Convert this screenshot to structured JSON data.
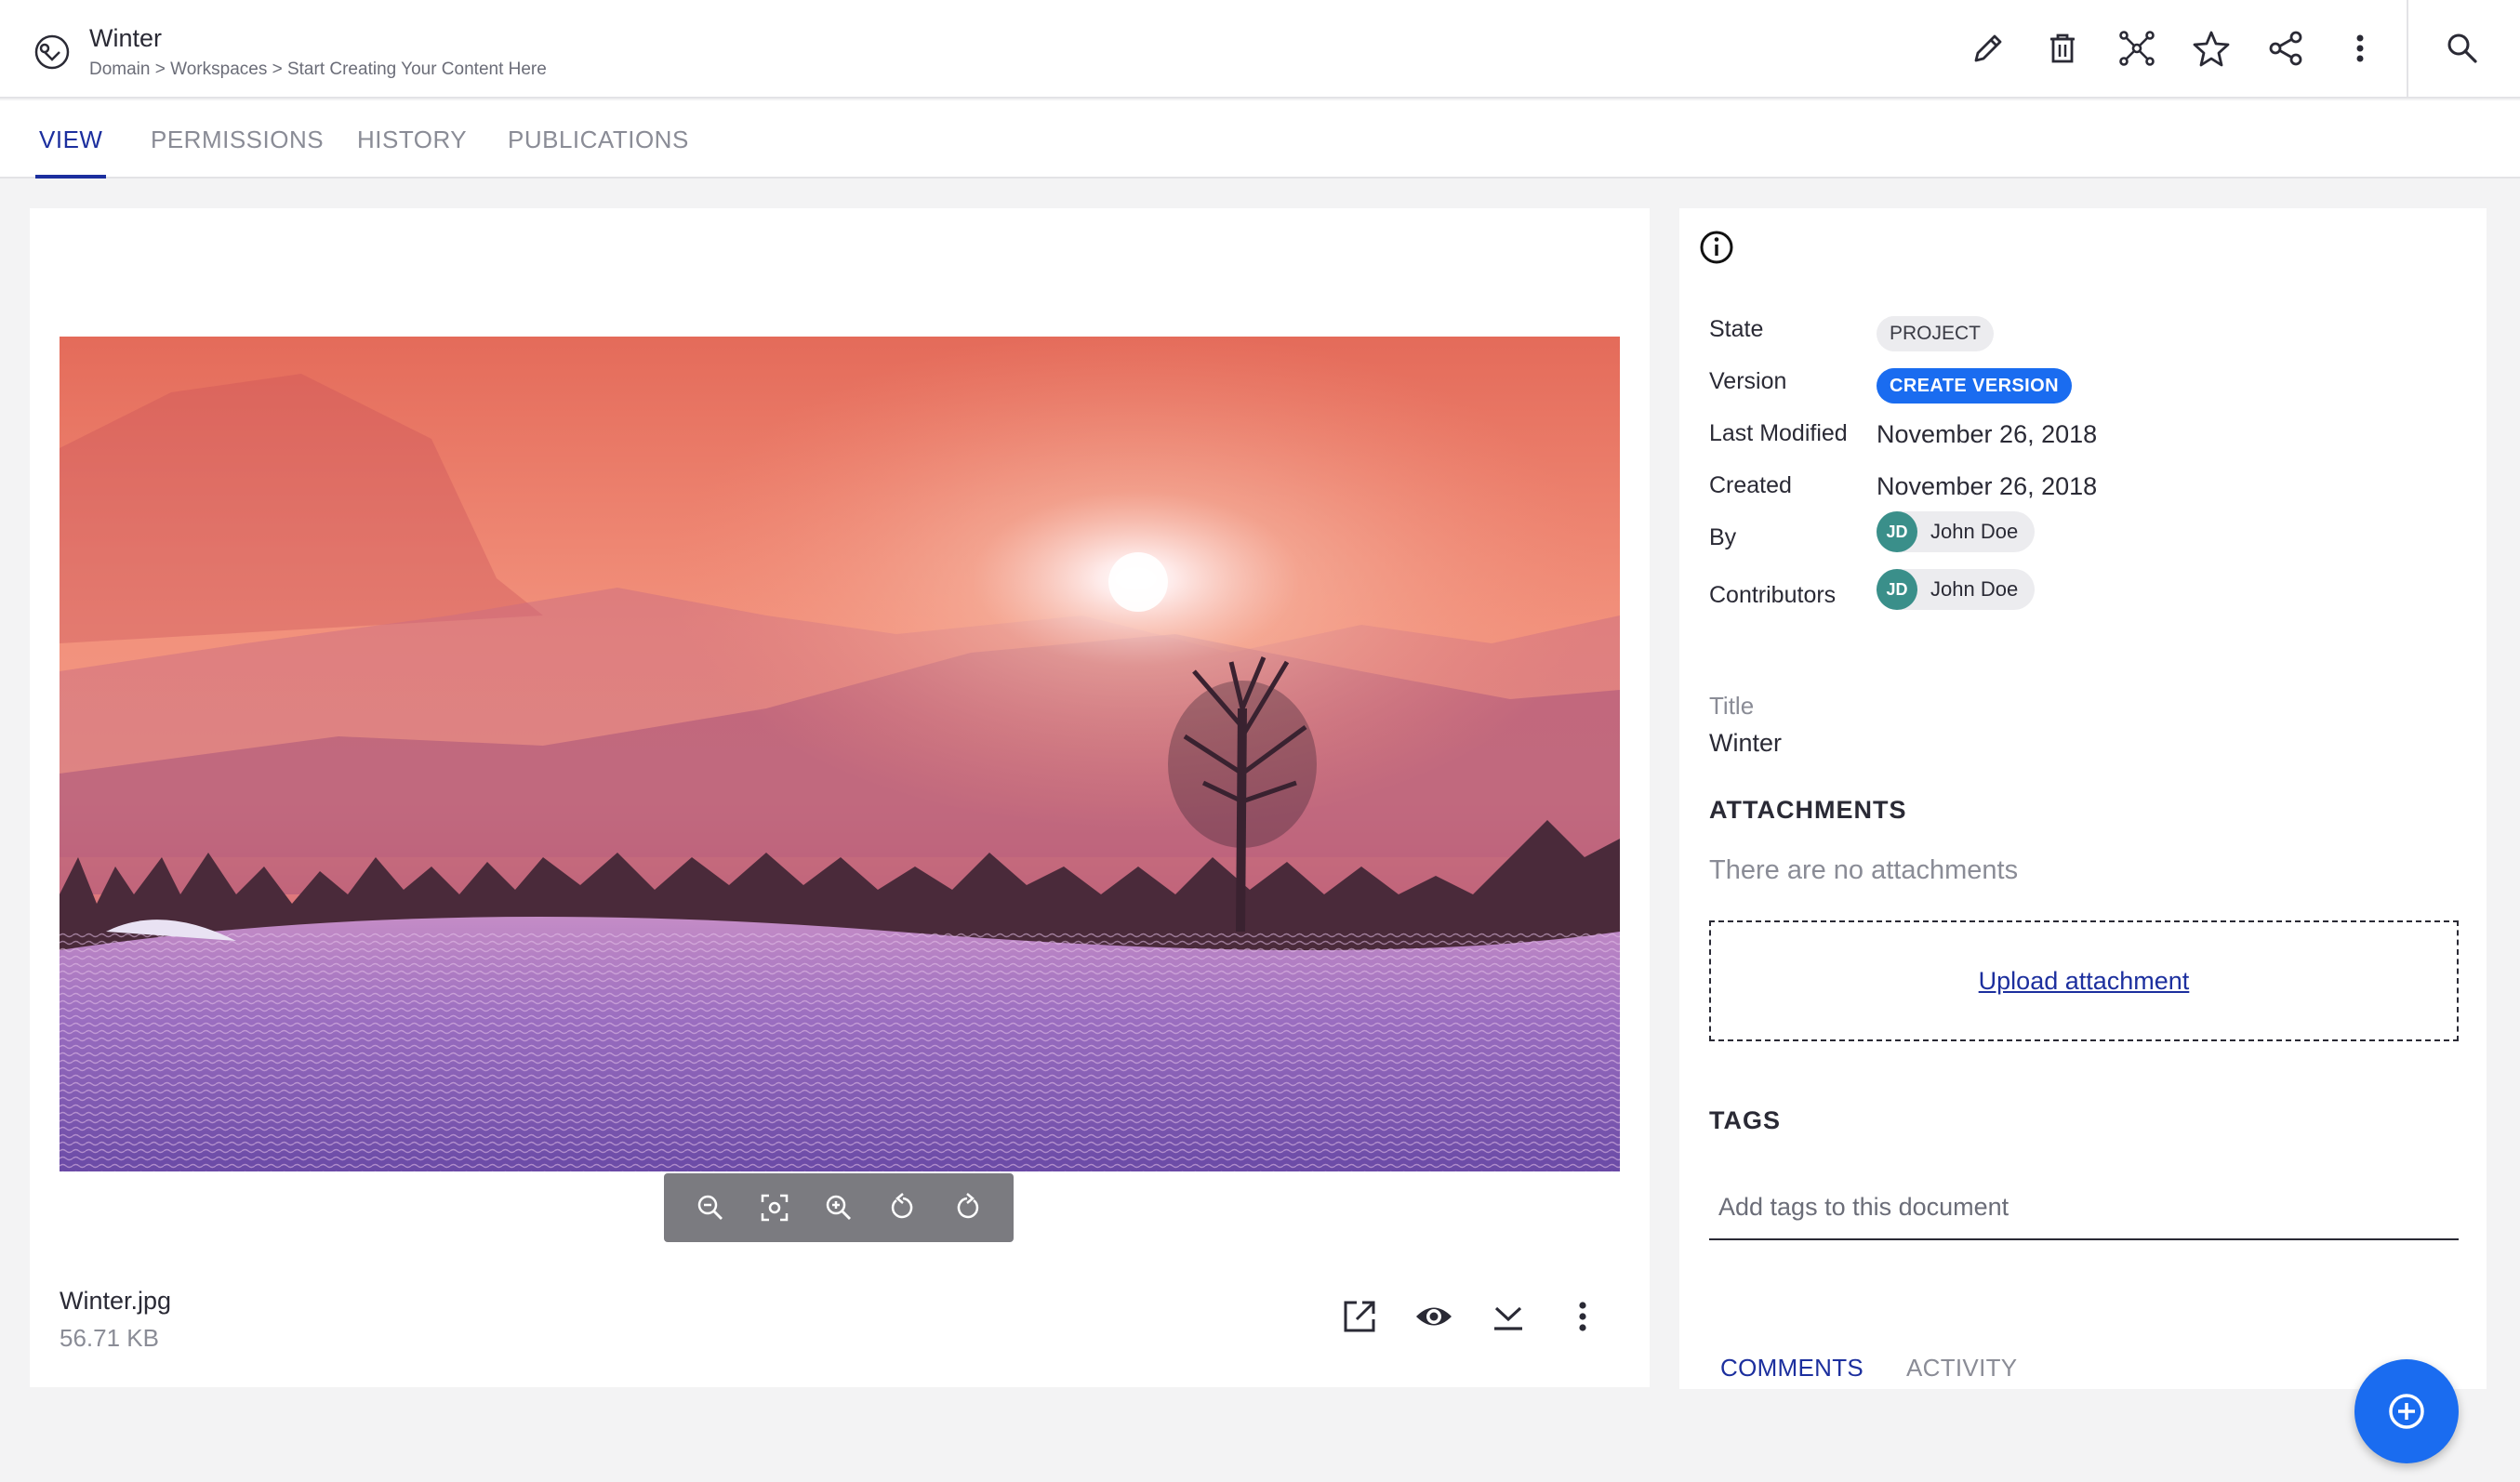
{
  "header": {
    "title": "Winter",
    "breadcrumb": [
      "Domain",
      "Workspaces",
      "Start Creating Your Content Here"
    ],
    "breadcrumb_sep": " > ",
    "actions": [
      "edit-icon",
      "delete-icon",
      "preview-icon",
      "favorite-icon",
      "share-icon",
      "more-icon"
    ],
    "search_icon": "search-icon"
  },
  "tabs": [
    {
      "label": "VIEW",
      "active": true
    },
    {
      "label": "PERMISSIONS",
      "active": false
    },
    {
      "label": "HISTORY",
      "active": false
    },
    {
      "label": "PUBLICATIONS",
      "active": false
    }
  ],
  "viewer": {
    "file_name": "Winter.jpg",
    "file_size": "56.71 KB",
    "zoom_controls": [
      "zoom-out-icon",
      "fit-icon",
      "zoom-in-icon",
      "rotate-left-icon",
      "rotate-right-icon"
    ],
    "file_actions": [
      "open-external-icon",
      "preview-eye-icon",
      "download-icon",
      "more-icon"
    ]
  },
  "info": {
    "labels": {
      "state": "State",
      "version": "Version",
      "last_modified": "Last Modified",
      "created": "Created",
      "by": "By",
      "contributors": "Contributors"
    },
    "state_value": "PROJECT",
    "version_button": "CREATE VERSION",
    "last_modified_value": "November 26, 2018",
    "created_value": "November 26, 2018",
    "by_user": {
      "initials": "JD",
      "name": "John Doe"
    },
    "contributor": {
      "initials": "JD",
      "name": "John Doe"
    },
    "title_label": "Title",
    "title_value": "Winter",
    "attachments_title": "ATTACHMENTS",
    "no_attachments": "There are no attachments",
    "upload_link": "Upload attachment",
    "tags_title": "TAGS",
    "tags_placeholder": "Add tags to this document",
    "bottom_tabs": [
      {
        "label": "COMMENTS",
        "active": true
      },
      {
        "label": "ACTIVITY",
        "active": false
      }
    ]
  },
  "colors": {
    "accent": "#1c2f9e",
    "primary_button": "#1a6cf0",
    "avatar": "#3a8f8a"
  }
}
